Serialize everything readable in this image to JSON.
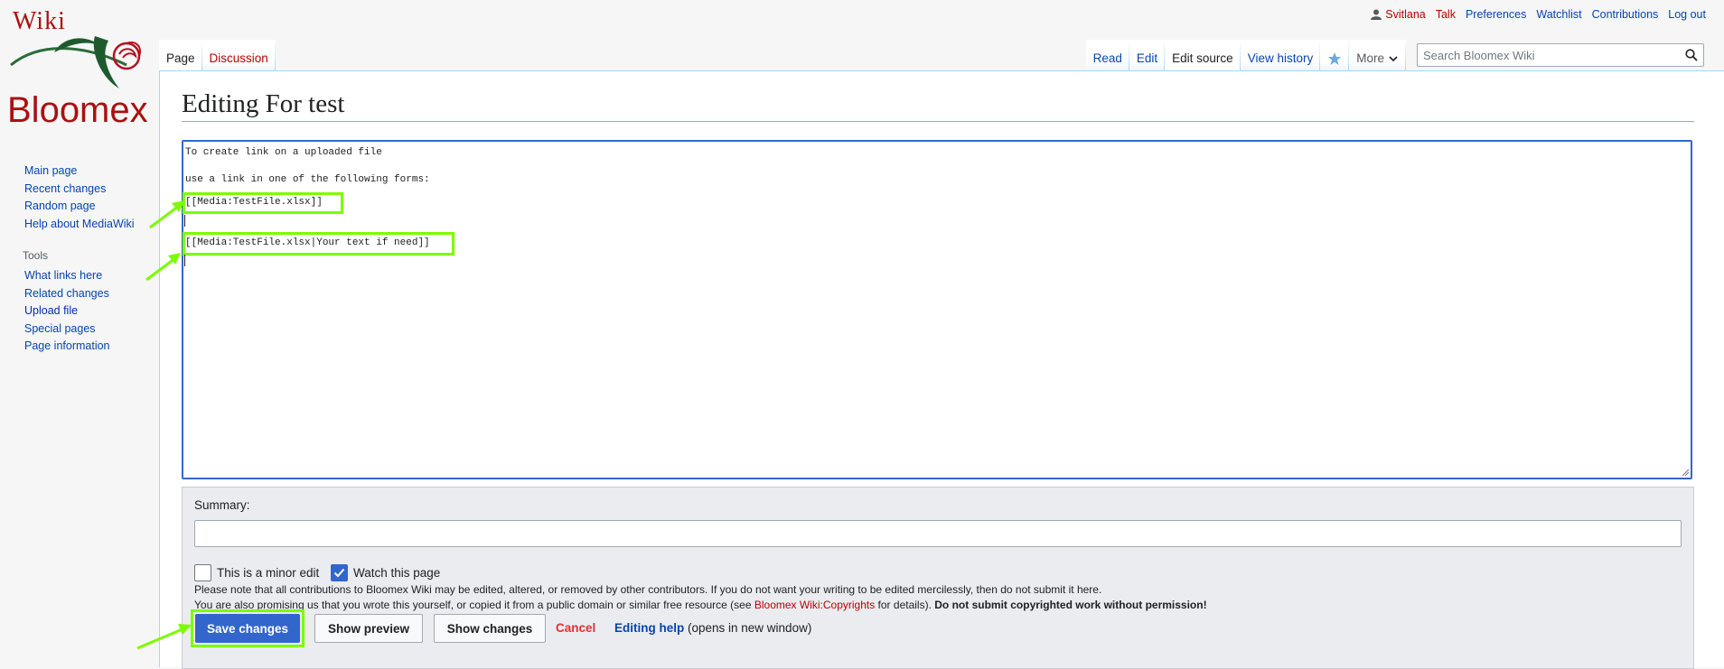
{
  "logo": {
    "top_text": "Wiki",
    "brand": "Bloomex"
  },
  "personal": {
    "username": "Svitlana",
    "items": [
      "Talk",
      "Preferences",
      "Watchlist",
      "Contributions",
      "Log out"
    ]
  },
  "sidebar": {
    "nav": [
      "Main page",
      "Recent changes",
      "Random page",
      "Help about MediaWiki"
    ],
    "tools_heading": "Tools",
    "tools": [
      "What links here",
      "Related changes",
      "Upload file",
      "Special pages",
      "Page information"
    ]
  },
  "tabs": {
    "left": [
      "Page",
      "Discussion"
    ],
    "right": [
      "Read",
      "Edit",
      "Edit source",
      "View history"
    ],
    "more": "More"
  },
  "search": {
    "placeholder": "Search Bloomex Wiki"
  },
  "page": {
    "title": "Editing For test"
  },
  "editor": {
    "lines": [
      "To create link on a uploaded file",
      "use a link in one of the following forms:",
      "[[Media:TestFile.xlsx]]",
      "[[Media:TestFile.xlsx|Your text if need]]"
    ]
  },
  "editoptions": {
    "summary_label": "Summary:",
    "minor_edit_label": "This is a minor edit",
    "minor_edit_checked": false,
    "watch_label": "Watch this page",
    "watch_checked": true,
    "notice1": "Please note that all contributions to Bloomex Wiki may be edited, altered, or removed by other contributors. If you do not want your writing to be edited mercilessly, then do not submit it here.",
    "notice2_pre": "You are also promising us that you wrote this yourself, or copied it from a public domain or similar free resource (see ",
    "notice2_link": "Bloomex Wiki:Copyrights",
    "notice2_mid": " for details). ",
    "notice2_bold": "Do not submit copyrighted work without permission!",
    "save_label": "Save changes",
    "preview_label": "Show preview",
    "changes_label": "Show changes",
    "cancel_label": "Cancel",
    "help_label": "Editing help",
    "help_note": " (opens in new window)"
  },
  "colors": {
    "highlight": "#7cfc00",
    "primary": "#3366cc",
    "link": "#0645ad",
    "redlink": "#ba0000"
  }
}
